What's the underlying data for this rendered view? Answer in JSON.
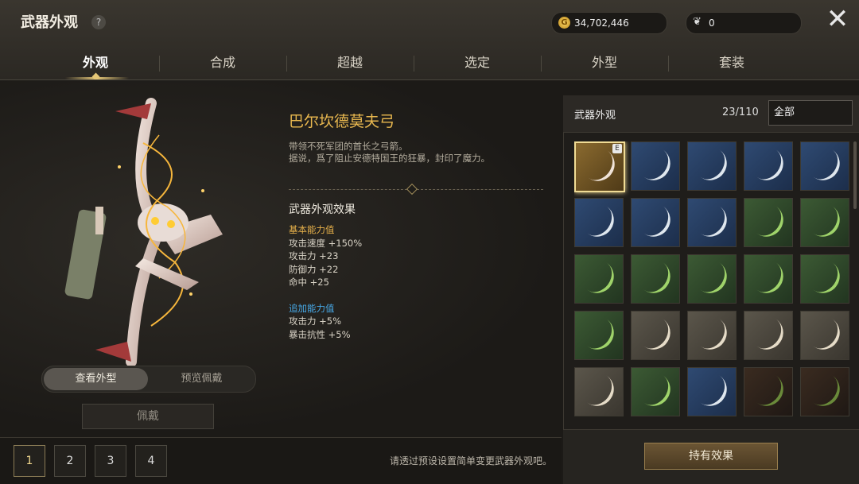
{
  "header": {
    "title": "武器外观",
    "help_label": "?",
    "gold": "34,702,446",
    "feathers": "0",
    "close_label": "✕"
  },
  "tabs": [
    {
      "label": "外观",
      "active": true
    },
    {
      "label": "合成",
      "active": false
    },
    {
      "label": "超越",
      "active": false
    },
    {
      "label": "选定",
      "active": false
    },
    {
      "label": "外型",
      "active": false
    },
    {
      "label": "套装",
      "active": false
    }
  ],
  "item": {
    "name": "巴尔坎德莫夫弓",
    "desc_line1": "带领不死军团的首长之弓箭。",
    "desc_line2": "据说，爲了阻止安德特国王的狂暴，封印了魔力。",
    "effects_title": "武器外观效果",
    "basic_title": "基本能力值",
    "basic_stats": [
      "攻击速度 +150%",
      "攻击力 +23",
      "防御力 +22",
      "命中 +25"
    ],
    "extra_title": "追加能力值",
    "extra_stats": [
      "攻击力 +5%",
      "暴击抗性 +5%"
    ]
  },
  "view_toggle": {
    "view_label": "查看外型",
    "preview_label": "预览佩戴"
  },
  "equip_label": "佩戴",
  "presets": [
    "1",
    "2",
    "3",
    "4"
  ],
  "preset_hint": "请透过预设设置简单变更武器外观吧。",
  "collection": {
    "title": "武器外观",
    "count": "23/110",
    "filter": "全部",
    "selected_badge": "E",
    "cells": [
      "gold",
      "blue",
      "blue",
      "blue",
      "blue",
      "blue",
      "blue",
      "blue",
      "green",
      "green",
      "green",
      "green",
      "green",
      "green",
      "green",
      "green",
      "gray",
      "gray",
      "gray",
      "gray",
      "gray",
      "green",
      "blue",
      "dark",
      "dark"
    ],
    "effect_button": "持有效果"
  },
  "colors": {
    "accent_gold": "#e9b84f",
    "accent_blue": "#47a8e6"
  }
}
